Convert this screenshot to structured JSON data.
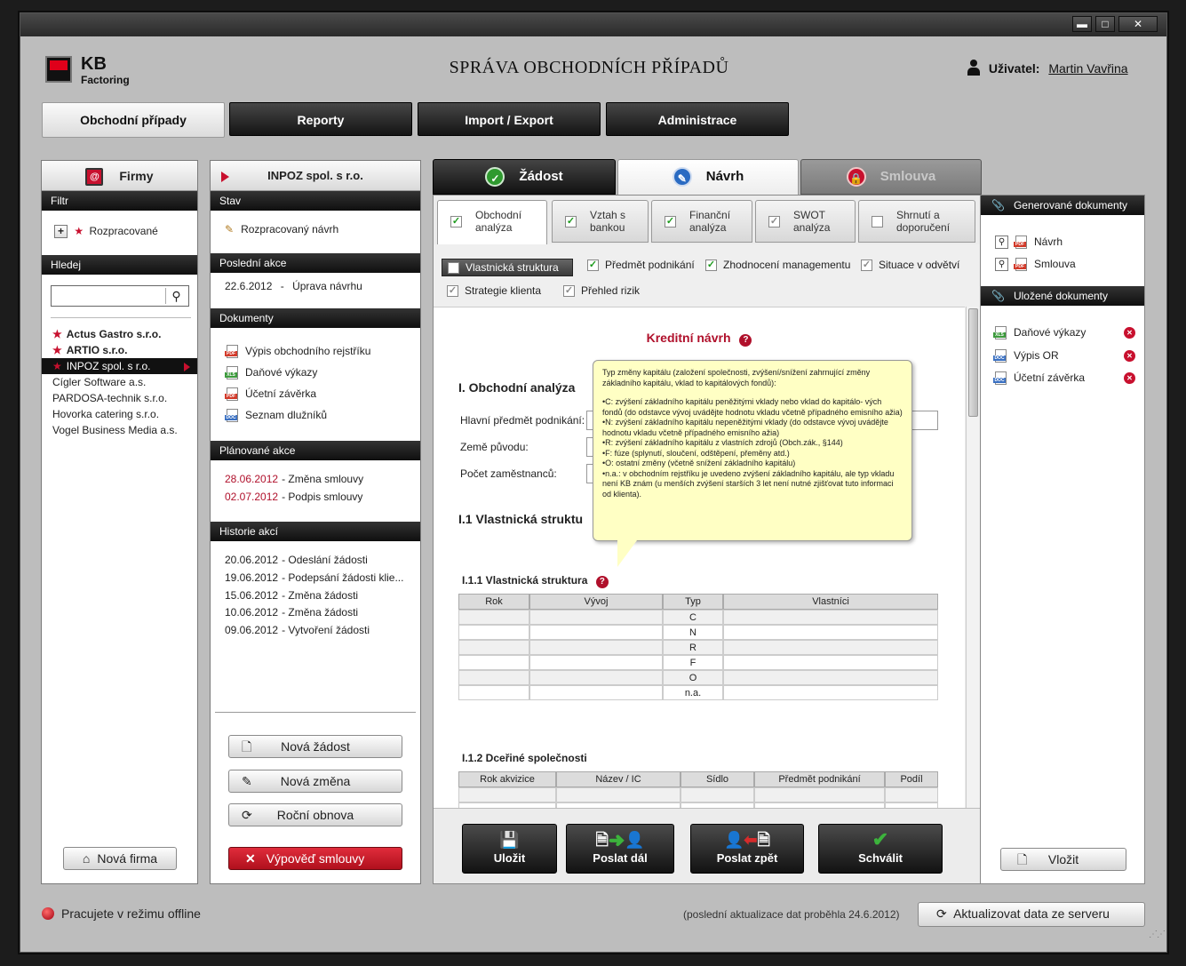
{
  "app": {
    "logo_brand": "KB",
    "logo_product": "Factoring",
    "title": "SPRÁVA OBCHODNÍCH PŘÍPADŮ",
    "user_label": "Uživatel:",
    "user_name": "Martin Vavřina"
  },
  "window_controls": {
    "minimize": "▬",
    "maximize": "□",
    "close": "✕"
  },
  "main_tabs": [
    "Obchodní případy",
    "Reporty",
    "Import / Export",
    "Administrace"
  ],
  "firms_panel": {
    "title": "Firmy",
    "filter_header": "Filtr",
    "filter_item": "Rozpracované",
    "search_header": "Hledej",
    "search_value": "",
    "companies": [
      {
        "name": "Actus Gastro s.r.o.",
        "starred": true,
        "bold": true
      },
      {
        "name": "ARTIO s.r.o.",
        "starred": true,
        "bold": true
      },
      {
        "name": "INPOZ spol. s r.o.",
        "starred": true,
        "selected": true
      },
      {
        "name": "Cígler Software a.s."
      },
      {
        "name": "PARDOSA-technik s.r.o."
      },
      {
        "name": "Hovorka catering s.r.o."
      },
      {
        "name": "Vogel Business Media a.s."
      }
    ],
    "new_firm_button": "Nová firma"
  },
  "detail_panel": {
    "title": "INPOZ spol. s r.o.",
    "state_header": "Stav",
    "state_value": "Rozpracovaný návrh",
    "last_action_header": "Poslední akce",
    "last_action_date": "22.6.2012",
    "last_action_sep": "-",
    "last_action_text": "Úprava návrhu",
    "documents_header": "Dokumenty",
    "documents": [
      {
        "name": "Výpis obchodního rejstříku",
        "type": "pdf",
        "badge": "PDF"
      },
      {
        "name": "Daňové výkazy",
        "type": "xls",
        "badge": "XLS"
      },
      {
        "name": "Účetní závěrka",
        "type": "pdf",
        "badge": "PDF"
      },
      {
        "name": "Seznam dlužníků",
        "type": "doc",
        "badge": "DOC"
      }
    ],
    "planned_header": "Plánované akce",
    "planned": [
      {
        "date": "28.06.2012",
        "text": "- Změna smlouvy"
      },
      {
        "date": "02.07.2012",
        "text": "- Podpis smlouvy"
      }
    ],
    "history_header": "Historie akcí",
    "history": [
      {
        "date": "20.06.2012",
        "text": "- Odeslání žádosti"
      },
      {
        "date": "19.06.2012",
        "text": "- Podepsání žádosti klie..."
      },
      {
        "date": "15.06.2012",
        "text": "- Změna žádosti"
      },
      {
        "date": "10.06.2012",
        "text": "- Změna žádosti"
      },
      {
        "date": "09.06.2012",
        "text": "- Vytvoření žádosti"
      }
    ],
    "buttons": {
      "new_request": "Nová žádost",
      "new_change": "Nová změna",
      "annual_renewal": "Roční obnova",
      "termination": "Výpověď smlouvy"
    }
  },
  "workflow_tabs": [
    {
      "label": "Žádost",
      "state": "done"
    },
    {
      "label": "Návrh",
      "state": "active"
    },
    {
      "label": "Smlouva",
      "state": "locked"
    }
  ],
  "sub_tabs": [
    {
      "line1": "Obchodní",
      "line2": "analýza",
      "checked": true,
      "active": true
    },
    {
      "line1": "Vztah s",
      "line2": "bankou",
      "checked": true
    },
    {
      "line1": "Finanční",
      "line2": "analýza",
      "checked": true
    },
    {
      "line1": "SWOT",
      "line2": "analýza",
      "checked": true,
      "grey": true
    },
    {
      "line1": "Shrnutí a",
      "line2": "doporučení",
      "checked": false
    }
  ],
  "section_filters": [
    {
      "label": "Vlastnická struktura",
      "checked": false,
      "active": true
    },
    {
      "label": "Předmět podnikání",
      "checked": true
    },
    {
      "label": "Zhodnocení managementu",
      "checked": true
    },
    {
      "label": "Situace v odvětví",
      "checked": true,
      "grey": true
    },
    {
      "label": "Strategie klienta",
      "checked": true,
      "grey": true
    },
    {
      "label": "Přehled rizik",
      "checked": true,
      "grey": true
    }
  ],
  "form": {
    "heading": "Kreditní návrh",
    "section1": "I. Obchodní analýza",
    "fields": [
      {
        "label": "Hlavní předmět podnikání:",
        "value": ""
      },
      {
        "label": "Země původu:",
        "value": ""
      },
      {
        "label": "Počet zaměstnanců:",
        "value": ""
      }
    ],
    "section11": "I.1 Vlastnická struktu",
    "section111": "I.1.1 Vlastnická struktura",
    "ownership_table": {
      "columns": [
        "Rok",
        "Vývoj",
        "Typ",
        "Vlastníci"
      ],
      "types": [
        "C",
        "N",
        "R",
        "F",
        "O",
        "n.a."
      ]
    },
    "section112": "I.1.2 Dceřiné společnosti",
    "subsidiaries_table": {
      "columns": [
        "Rok akvizice",
        "Název / IC",
        "Sídlo",
        "Předmět podnikání",
        "Podíl"
      ]
    }
  },
  "tooltip": {
    "intro": "Typ změny kapitálu (založení společnosti, zvýšení/snížení zahrnující změny základního kapitálu, vklad to kapitálových fondů):",
    "items": [
      "•C:  zvýšení základního kapitálu peněžitými vklady nebo vklad do kapitálo- vých fondů (do odstavce vývoj uvádějte hodnotu vkladu včetně případného emisního ažia)",
      "•N:  zvýšení základního kapitálu nepeněžitými vklady (do odstavce vývoj uvádějte hodnotu vkladu včetně případného emisního ažia)",
      "•R: zvýšení základního kapitálu z vlastních zdrojů (Obch.zák., §144)",
      "•F:  fúze (splynutí, sloučení, odštěpení, přeměny atd.)",
      "•O:  ostatní změny (včetně snížení základního kapitálu)",
      "•n.a.:  v obchodním rejstříku je uvedeno zvýšení základního kapitálu, ale typ vkladu není KB znám (u menších zvýšení starších 3 let není nutné zjišťovat tuto informaci od klienta)."
    ]
  },
  "action_buttons": [
    "Uložit",
    "Poslat dál",
    "Poslat zpět",
    "Schválit"
  ],
  "generated_docs": {
    "header": "Generované dokumenty",
    "items": [
      {
        "name": "Návrh",
        "badge": "PDF"
      },
      {
        "name": "Smlouva",
        "badge": "PDF"
      }
    ]
  },
  "saved_docs": {
    "header": "Uložené dokumenty",
    "items": [
      {
        "name": "Daňové výkazy",
        "type": "xls",
        "badge": "XLS"
      },
      {
        "name": "Výpis OR",
        "type": "doc",
        "badge": "DOC"
      },
      {
        "name": "Účetní závěrka",
        "type": "doc",
        "badge": "DOC"
      }
    ],
    "insert_button": "Vložit"
  },
  "status": {
    "offline_text": "Pracujete v režimu offline",
    "last_update": "(poslední aktualizace dat proběhla 24.6.2012)",
    "update_button": "Aktualizovat data ze serveru"
  },
  "colors": {
    "accent_red": "#c8102e",
    "check_green": "#1c9a1c",
    "tooltip_bg": "#ffffc4"
  }
}
